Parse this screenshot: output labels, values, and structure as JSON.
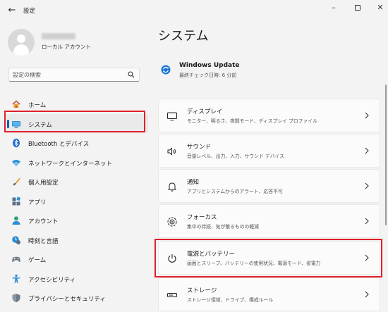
{
  "window": {
    "title": "設定"
  },
  "account": {
    "type": "ローカル アカウント"
  },
  "search": {
    "placeholder": "設定の検索"
  },
  "nav": {
    "items": [
      {
        "label": "ホーム",
        "icon": "home-icon"
      },
      {
        "label": "システム",
        "icon": "monitor-icon",
        "active": true
      },
      {
        "label": "Bluetooth とデバイス",
        "icon": "bluetooth-icon"
      },
      {
        "label": "ネットワークとインターネット",
        "icon": "wifi-icon"
      },
      {
        "label": "個人用設定",
        "icon": "paintbrush-icon"
      },
      {
        "label": "アプリ",
        "icon": "apps-icon"
      },
      {
        "label": "アカウント",
        "icon": "person-icon"
      },
      {
        "label": "時刻と言語",
        "icon": "clock-globe-icon"
      },
      {
        "label": "ゲーム",
        "icon": "gamepad-icon"
      },
      {
        "label": "アクセシビリティ",
        "icon": "accessibility-icon"
      },
      {
        "label": "プライバシーとセキュリティ",
        "icon": "shield-icon"
      }
    ]
  },
  "main": {
    "title": "システム",
    "windows_update": {
      "title": "Windows Update",
      "subtitle": "最終チェック日時: 6 分前"
    },
    "cards": [
      {
        "title": "ディスプレイ",
        "subtitle": "モニター、明るさ、夜間モード、ディスプレイ プロファイル",
        "icon": "display-icon"
      },
      {
        "title": "サウンド",
        "subtitle": "音量レベル、出力、入力、サウンド デバイス",
        "icon": "speaker-icon"
      },
      {
        "title": "通知",
        "subtitle": "アプリとシステムからのアラート、応答不可",
        "icon": "bell-icon"
      },
      {
        "title": "フォーカス",
        "subtitle": "集中の持続、気が散るものの軽減",
        "icon": "focus-icon"
      },
      {
        "title": "電源とバッテリー",
        "subtitle": "画面とスリープ、バッテリーの使用状況、電源モード、省電力",
        "icon": "power-icon"
      },
      {
        "title": "ストレージ",
        "subtitle": "ストレージ領域、ドライブ、構成ルール",
        "icon": "storage-icon"
      }
    ]
  },
  "colors": {
    "accent": "#005fb8",
    "highlight": "#e0202a"
  }
}
